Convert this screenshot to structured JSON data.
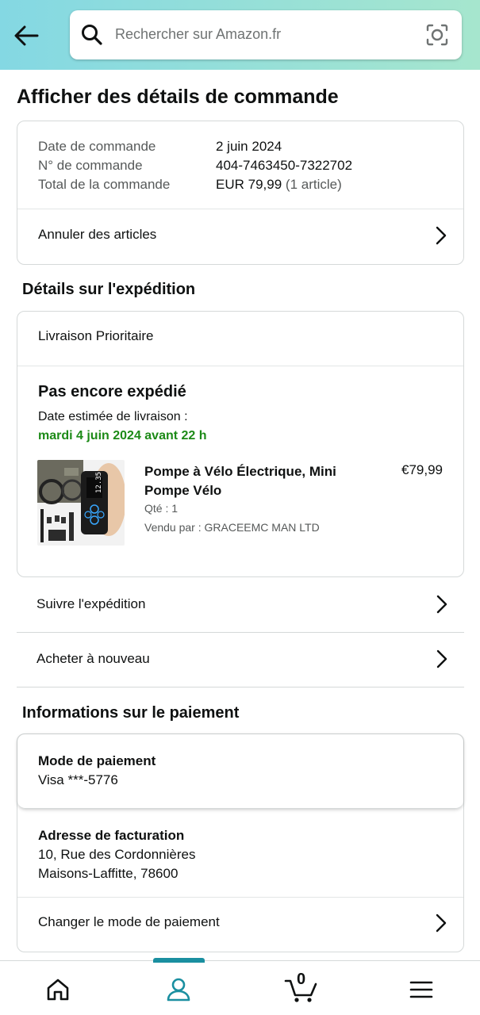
{
  "header": {
    "search_placeholder": "Rechercher sur Amazon.fr"
  },
  "page_title": "Afficher des détails de commande",
  "order_summary": {
    "rows": [
      {
        "label": "Date de commande",
        "value": "2 juin 2024",
        "extra": ""
      },
      {
        "label": "N° de commande",
        "value": "404-7463450-7322702",
        "extra": ""
      },
      {
        "label": "Total de la commande",
        "value": "EUR 79,99",
        "extra": "(1 article)"
      }
    ],
    "cancel_label": "Annuler des articles"
  },
  "shipping": {
    "section_title": "Détails sur l'expédition",
    "method": "Livraison Prioritaire",
    "status": "Pas encore expédié",
    "eta_label": "Date estimée de livraison :",
    "eta_date": "mardi 4 juin 2024 avant 22 h",
    "product": {
      "title": "Pompe à Vélo Électrique, Mini Pompe Vélo",
      "qty": "Qté : 1",
      "seller": "Vendu par : GRACEEMC MAN LTD",
      "price": "€79,99",
      "screen_text": "12.35"
    },
    "track_label": "Suivre l'expédition",
    "buy_again_label": "Acheter à nouveau"
  },
  "payment": {
    "section_title": "Informations sur le paiement",
    "method_title": "Mode de paiement",
    "method_value": "Visa  ***-5776",
    "billing_title": "Adresse de facturation",
    "billing_line1": "10, Rue des Cordonnières",
    "billing_line2": "Maisons-Laffitte, 78600",
    "change_label": "Changer le mode de paiement"
  },
  "bottom_nav": {
    "cart_count": "0",
    "active_tab": "account",
    "accent_color": "#1a8fa0"
  }
}
